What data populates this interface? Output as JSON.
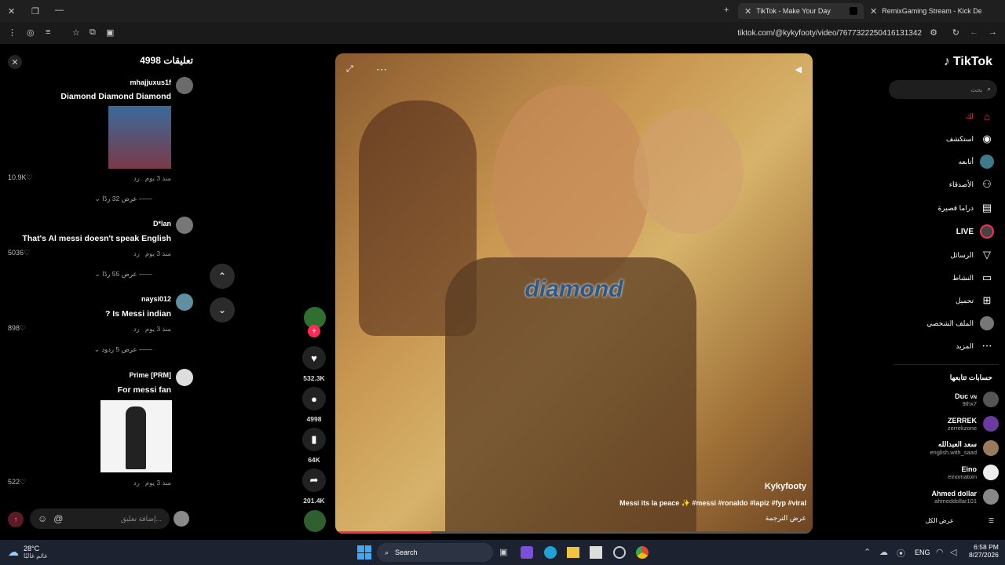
{
  "browser": {
    "tabs": [
      {
        "title": "TikTok - Make Your Day"
      },
      {
        "title": "RemixGaming Stream - Kick De"
      }
    ],
    "url": "tiktok.com/@kykyfooty/video/7677322250416131342"
  },
  "comments": {
    "title": "تعليقات 4998",
    "items": [
      {
        "user": "mhajjuxus1f",
        "text": "Diamond Diamond Diamond",
        "time": "منذ 3 يوم",
        "reply": "رد",
        "likes": "10.9K",
        "replies": "عرض 32 ردًا"
      },
      {
        "user": "D*lan",
        "text": "That's Al messi doesn't speak English",
        "time": "منذ 3 يوم",
        "reply": "رد",
        "likes": "5036",
        "replies": "عرض 55 ردًا"
      },
      {
        "user": "naysi012",
        "text": "? Is Messi indian",
        "time": "منذ 3 يوم",
        "reply": "رد",
        "likes": "898",
        "replies": "عرض 5 ردود"
      },
      {
        "user": "Prime [PRM]",
        "text": "For messi fan",
        "time": "منذ 3 يوم",
        "reply": "رد",
        "likes": "522"
      }
    ],
    "input_placeholder": "إضافة تعليق..."
  },
  "video": {
    "overlay_text": "diamond",
    "author": "Kykyfooty",
    "caption": "Messi its la peace ✨ #messi #ronaldo #lapiz #fyp #viral",
    "translate": "عرض الترجمة",
    "progress": 0.2
  },
  "actions": {
    "likes": "532.3K",
    "comments": "4998",
    "saves": "64K",
    "shares": "201.4K"
  },
  "nav": {
    "logo": "TikTok",
    "search_placeholder": "بحث",
    "items": [
      {
        "label": "لك",
        "icon": "home-icon"
      },
      {
        "label": "استكشف",
        "icon": "compass-icon"
      },
      {
        "label": "أتابعه",
        "icon": "following-icon"
      },
      {
        "label": "الأصدقاء",
        "icon": "friends-icon"
      },
      {
        "label": "دراما قصيرة",
        "icon": "film-icon"
      },
      {
        "label": "LIVE",
        "icon": "live-icon"
      },
      {
        "label": "الرسائل",
        "icon": "send-icon"
      },
      {
        "label": "النشاط",
        "icon": "activity-icon"
      },
      {
        "label": "تحميل",
        "icon": "upload-icon"
      },
      {
        "label": "الملف الشخصي",
        "icon": "profile-icon"
      },
      {
        "label": "المزيد",
        "icon": "more-icon"
      }
    ],
    "following_title": "حسابات تتابعها",
    "following": [
      {
        "name": "Duc",
        "badge": "VN",
        "handle": "9thx7"
      },
      {
        "name": "ZERREK",
        "handle": "zerrekzone"
      },
      {
        "name": "سعد العبدالله",
        "handle": "english.with_saad"
      },
      {
        "name": "Eino",
        "handle": "einomatoin"
      },
      {
        "name": "Ahmed dollar",
        "handle": "ahmeddollar101"
      }
    ],
    "see_all": "عرض الكل"
  },
  "taskbar": {
    "weather_temp": "28°C",
    "weather_desc": "غائم غالبًا",
    "search": "Search",
    "lang": "ENG",
    "time": "6:58 PM",
    "date": "8/27/2026"
  },
  "colors": {
    "accent": "#fe2c55",
    "bg": "#000000"
  }
}
